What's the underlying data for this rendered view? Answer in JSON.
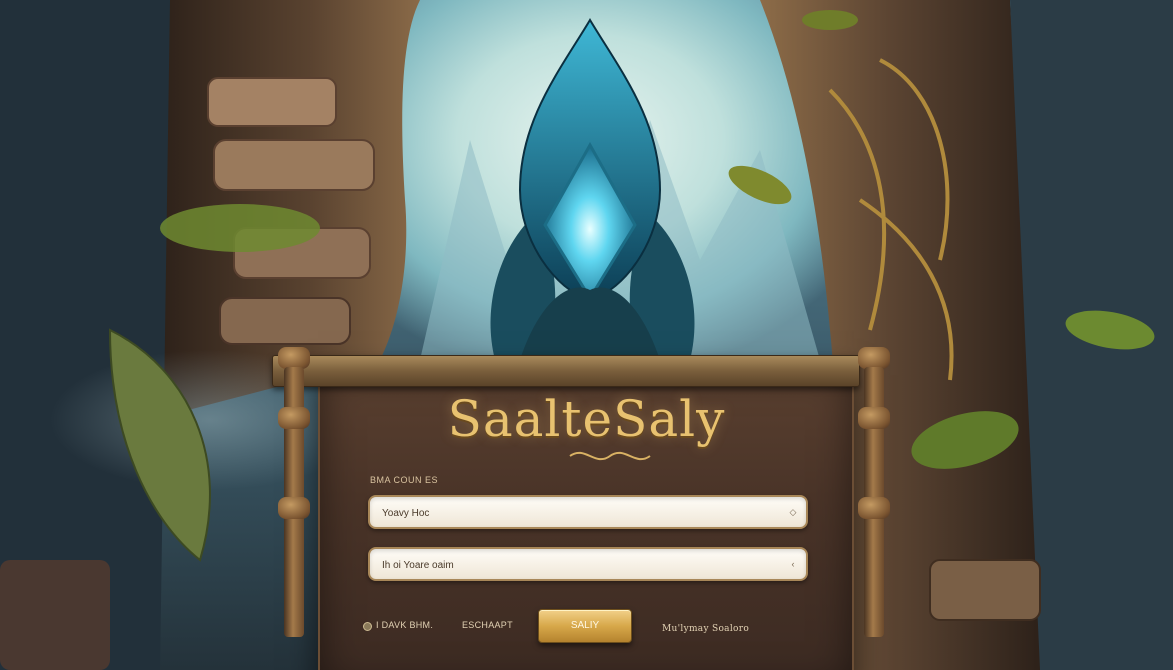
{
  "title": "SaalteSaly",
  "form": {
    "section_label": "BMA COUN ES",
    "field1_placeholder": "Yoavy Hoc",
    "field2_placeholder": "Ih oi Yoare oaim"
  },
  "footer": {
    "remember_label": "I DAVK BHM.",
    "link_label": "ESCHAAPT",
    "submit_label": "SALIY",
    "help_text": "Mu'lymay Soaloro"
  },
  "colors": {
    "title_gold": "#e8c270",
    "panel_brown": "#4a3428",
    "button_gold": "#d7a84a",
    "crystal_cyan": "#5fd6f0"
  }
}
